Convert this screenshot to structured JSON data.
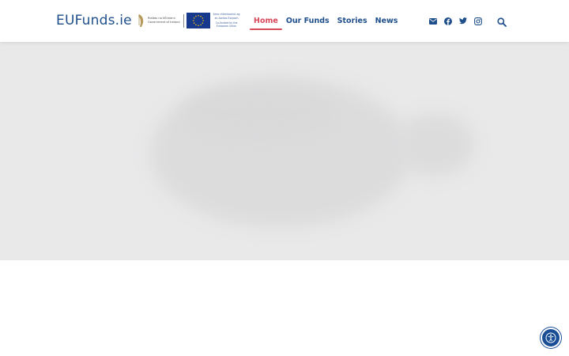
{
  "header": {
    "brand": "EUFunds.ie",
    "gov_logo_text": [
      "Rialtas na hÉireann",
      "Government of Ireland"
    ],
    "eu_logo_text": [
      "Arna chómhaoiniú ag",
      "an Aontas Eorpach",
      "Co-funded by the",
      "European Union"
    ],
    "nav": [
      {
        "label": "Home",
        "active": true
      },
      {
        "label": "Our Funds",
        "active": false
      },
      {
        "label": "Stories",
        "active": false
      },
      {
        "label": "News",
        "active": false
      }
    ],
    "social_icons": [
      "envelope-icon",
      "facebook-icon",
      "twitter-icon",
      "instagram-icon"
    ],
    "search_icon": "search-icon"
  },
  "colors": {
    "brand": "#1f4f8a",
    "active_nav": "#d8485a",
    "hero_bg": "#e9e9ea",
    "eu_blue": "#16398e",
    "eu_gold": "#ffcc00",
    "accessibility": "#1a4f96"
  },
  "accessibility_button_icon": "accessibility-icon"
}
